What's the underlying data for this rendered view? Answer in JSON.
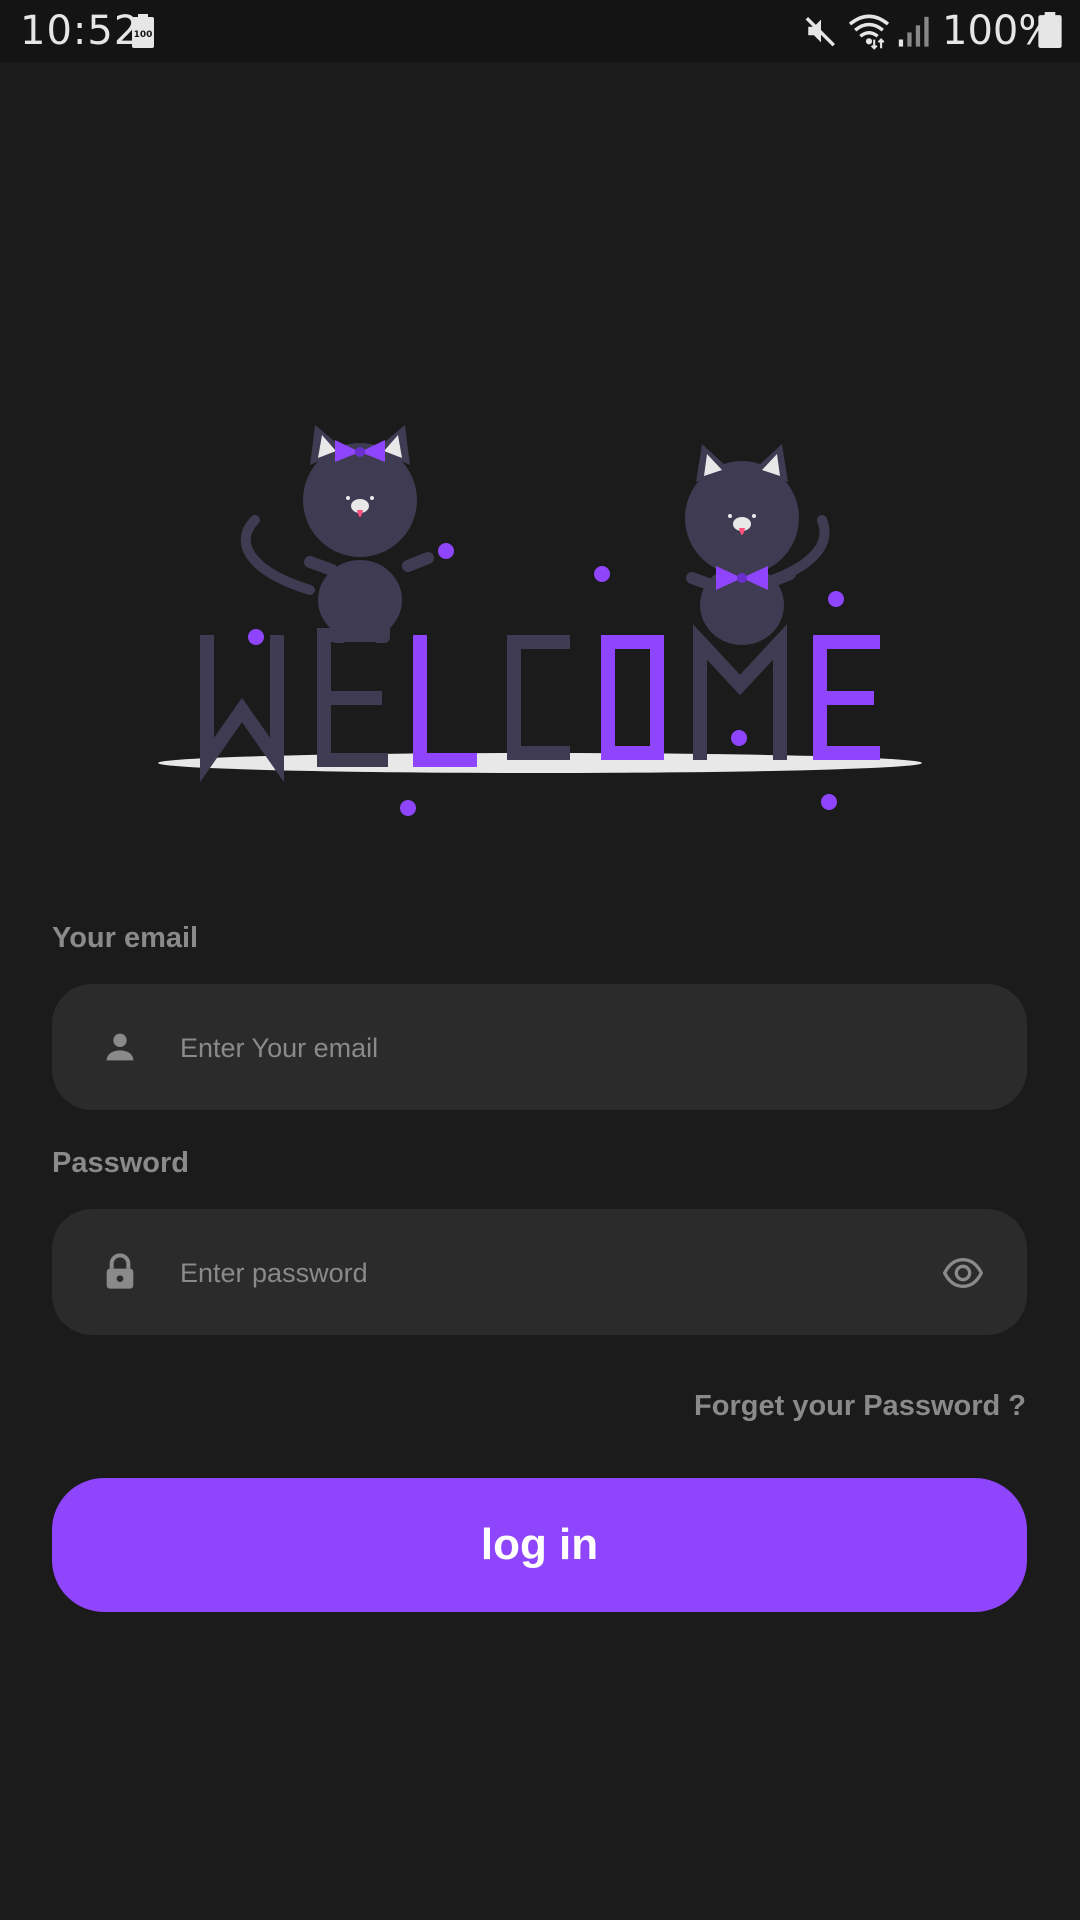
{
  "status_bar": {
    "time": "10:52",
    "battery_small_label": "100",
    "battery_percent": "100%",
    "icons": [
      "battery-saver-icon",
      "mute-icon",
      "wifi-icon",
      "signal-icon",
      "battery-icon"
    ]
  },
  "illustration": {
    "letters": [
      "W",
      "E",
      "L",
      "C",
      "O",
      "M",
      "E"
    ],
    "letter_colors": [
      "#3f3b52",
      "#3f3b52",
      "#8f45fc",
      "#3f3b52",
      "#8f45fc",
      "#3f3b52",
      "#8f45fc"
    ],
    "icon": "welcome-cats-illustration"
  },
  "login_form": {
    "email_label": "Your email",
    "email_placeholder": "Enter Your email",
    "email_value": "",
    "email_icon": "person-icon",
    "password_label": "Password",
    "password_placeholder": "Enter password",
    "password_value": "",
    "password_icon": "lock-icon",
    "password_toggle_icon": "eye-icon",
    "forgot_label": "Forget your Password ?",
    "login_button_label": "log in"
  },
  "colors": {
    "accent": "#8f45fc",
    "background": "#1b1b1b",
    "field_background": "#2b2b2b",
    "muted_text": "#8a8a8a"
  }
}
